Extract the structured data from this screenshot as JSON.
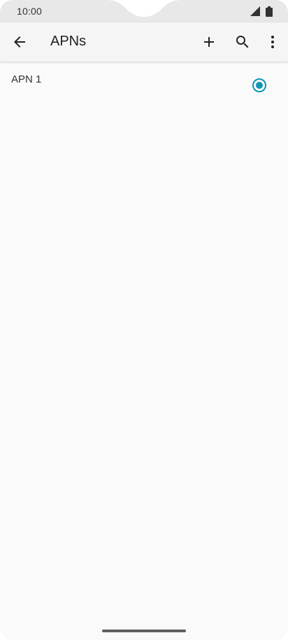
{
  "status_bar": {
    "time": "10:00",
    "icons": [
      "cellular-signal-icon",
      "battery-icon"
    ]
  },
  "app_bar": {
    "title": "APNs",
    "actions": [
      "back-arrow-icon",
      "add-icon",
      "search-icon",
      "more-vert-icon"
    ]
  },
  "apn_list": {
    "items": [
      {
        "label": "APN 1",
        "selected": true
      }
    ]
  },
  "colors": {
    "accent": "#0f95b3",
    "background": "#fafafa",
    "app_bar": "#f5f5f5",
    "status_bar": "#e8e8e8"
  }
}
